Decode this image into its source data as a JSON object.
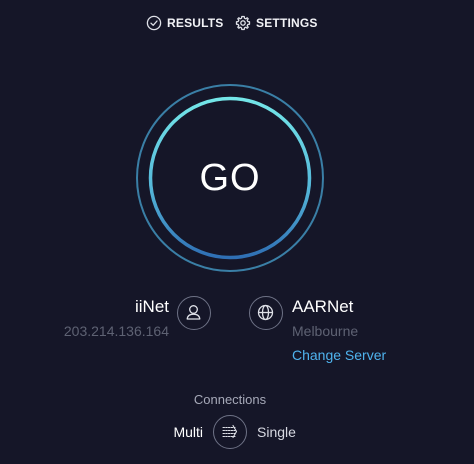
{
  "nav": {
    "results_label": "RESULTS",
    "settings_label": "SETTINGS"
  },
  "go_button": {
    "label": "GO"
  },
  "isp": {
    "name": "iiNet",
    "ip": "203.214.136.164",
    "icon": "user-icon"
  },
  "server": {
    "name": "AARNet",
    "location": "Melbourne",
    "change_label": "Change Server",
    "icon": "globe-icon"
  },
  "connections": {
    "title": "Connections",
    "multi_label": "Multi",
    "single_label": "Single",
    "selected": "Multi",
    "toggle_icon": "multi-connection-icon"
  },
  "colors": {
    "background": "#151628",
    "ring_cyan": "#6fe0e6",
    "ring_blue": "#3a7fa6",
    "link": "#4fb3ee",
    "muted_text": "#5e6273"
  }
}
